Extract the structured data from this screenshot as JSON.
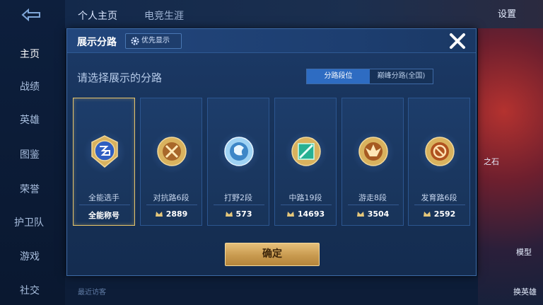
{
  "background": {
    "top_tabs": [
      "个人主页",
      "电竞生涯"
    ],
    "settings_label": "设置",
    "sidebar": [
      "主页",
      "战绩",
      "英雄",
      "图鉴",
      "荣誉",
      "护卫队",
      "游戏",
      "社交"
    ],
    "recent_label": "最近访客",
    "right_labels": [
      "之石",
      "模型",
      "换英雄"
    ]
  },
  "dialog": {
    "title": "展示分路",
    "priority_button": "优先显示",
    "subtitle": "请选择展示的分路",
    "segments": [
      "分路段位",
      "巅峰分路(全国)"
    ],
    "confirm_label": "确定",
    "cards": [
      {
        "name": "全能选手",
        "score": "全能称号",
        "selected": true,
        "color": "#3a6fd1"
      },
      {
        "name": "对抗路6段",
        "score": "2889",
        "selected": false,
        "color": "#c27a2c"
      },
      {
        "name": "打野2段",
        "score": "573",
        "selected": false,
        "color": "#5fa8e6"
      },
      {
        "name": "中路19段",
        "score": "14693",
        "selected": false,
        "color": "#2fb89a"
      },
      {
        "name": "游走8段",
        "score": "3504",
        "selected": false,
        "color": "#d48a3a"
      },
      {
        "name": "发育路6段",
        "score": "2592",
        "selected": false,
        "color": "#d46b2c"
      }
    ]
  },
  "colors": {
    "accent_gold": "#e7c07a",
    "segment_active": "#2e6cc2",
    "dialog_bg": "#173258"
  }
}
